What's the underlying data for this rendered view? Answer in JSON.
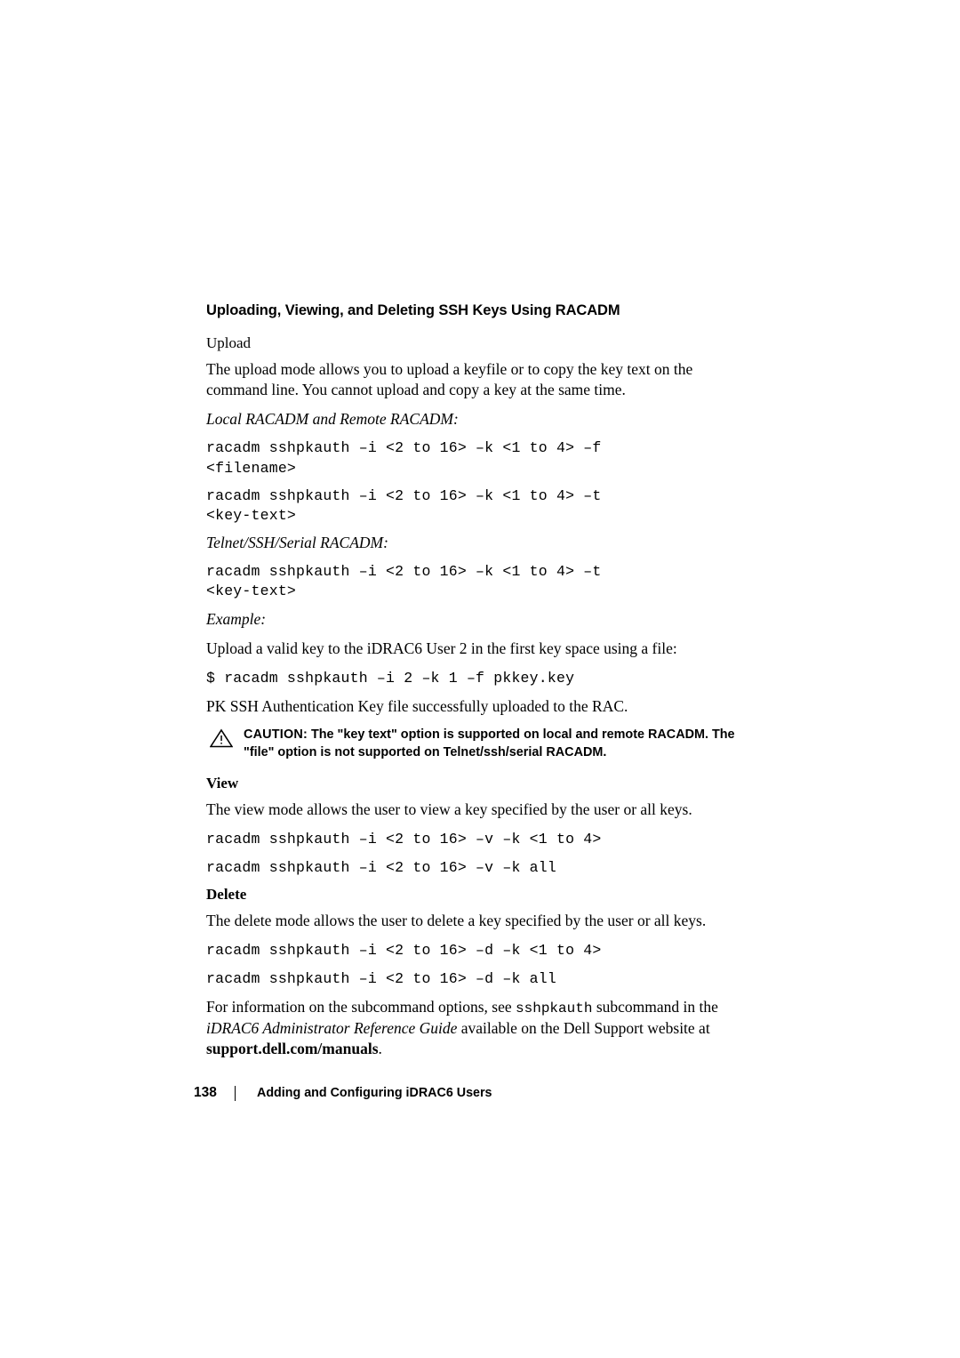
{
  "document": {
    "section_title": "Uploading, Viewing, and Deleting SSH Keys Using RACADM",
    "upload": {
      "heading": "Upload",
      "paragraph": "The upload mode allows you to upload a keyfile or to copy the key text on the command line. You cannot upload and copy a key at the same time.",
      "local_remote_label": "Local RACADM and Remote RACADM:",
      "code_1": "racadm sshpkauth –i <2 to 16> –k <1 to 4> –f\n<filename>",
      "code_2": "racadm sshpkauth –i <2 to 16> –k <1 to 4> –t\n<key-text>",
      "telnet_label": "Telnet/SSH/Serial RACADM:",
      "code_3": "racadm sshpkauth –i <2 to 16> –k <1 to 4> –t\n<key-text>",
      "example_label": "Example:",
      "example_text": "Upload a valid key to the iDRAC6 User 2 in the first key space using a file:",
      "example_code": "$ racadm sshpkauth –i 2 –k 1 –f pkkey.key",
      "example_result": "PK SSH Authentication Key file successfully uploaded to the RAC."
    },
    "caution": {
      "icon": "warning-triangle-icon",
      "label": "CAUTION:",
      "text": " The \"key text\" option is supported on local and remote RACADM. The \"file\" option is not supported on Telnet/ssh/serial RACADM."
    },
    "view": {
      "heading": "View",
      "paragraph": "The view mode allows the user to view a key specified by the user or all keys.",
      "code_1": "racadm sshpkauth –i <2 to 16> –v –k <1 to 4>",
      "code_2": "racadm sshpkauth –i <2 to 16> –v –k all"
    },
    "delete": {
      "heading": "Delete",
      "paragraph": "The delete mode allows the user to delete a key specified by the user or all keys.",
      "code_1": "racadm sshpkauth –i <2 to 16> –d –k <1 to 4>",
      "code_2": "racadm sshpkauth –i <2 to 16> –d –k all"
    },
    "closing": {
      "part_1": "For information on the subcommand options, see ",
      "mono_1": "sshpkauth",
      "part_2": " subcommand in the ",
      "italic_1": "iDRAC6 Administrator Reference Guide",
      "part_3": " available on the Dell Support website at ",
      "bold_1": "support.dell.com/manuals",
      "part_4": "."
    },
    "footer": {
      "page_number": "138",
      "title": "Adding and Configuring iDRAC6 Users"
    }
  }
}
